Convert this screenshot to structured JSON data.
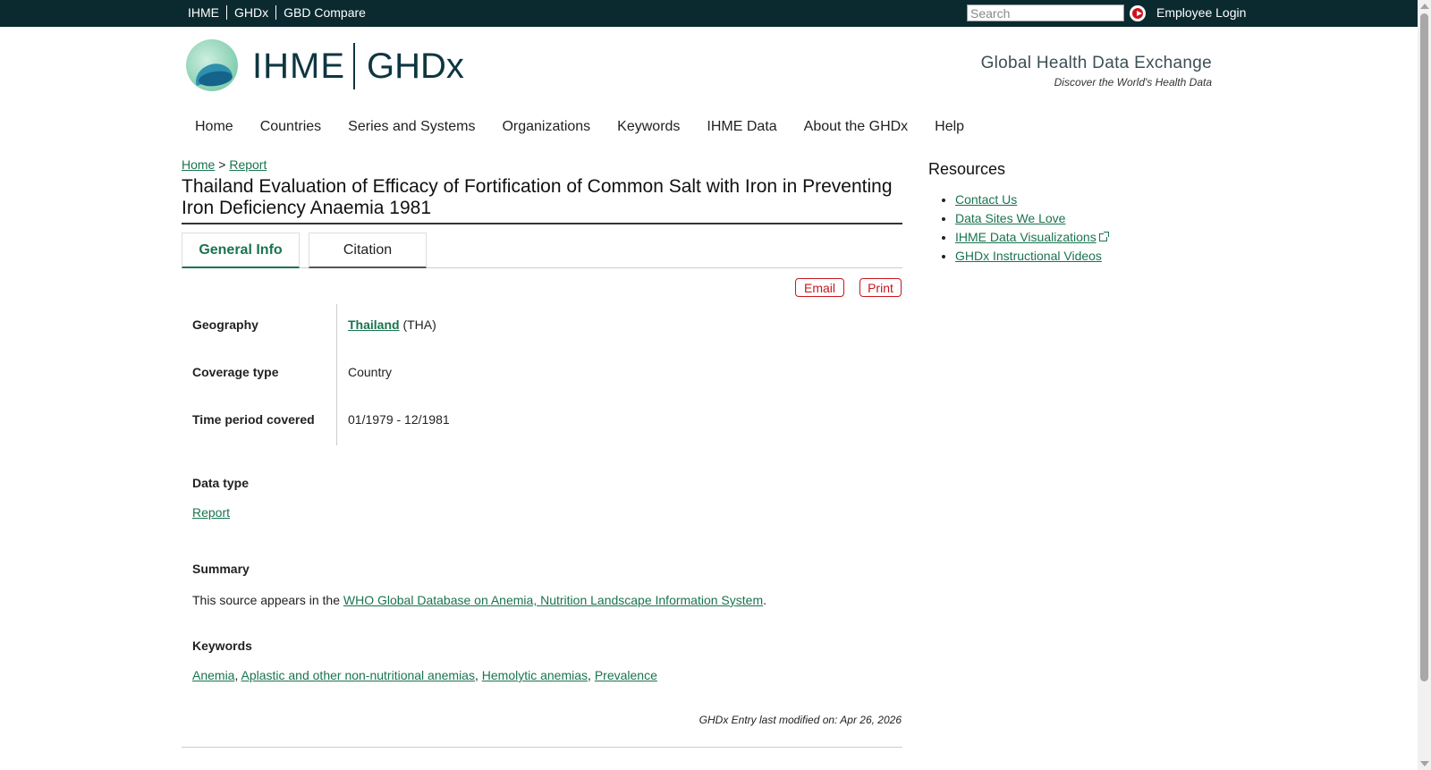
{
  "topbar": {
    "links": [
      "IHME",
      "GHDx",
      "GBD Compare"
    ],
    "search_placeholder": "Search",
    "login_label": "Employee Login",
    "bg_color": "#0b2a2f"
  },
  "header": {
    "logo_ihme": "IHME",
    "logo_ghdx": "GHDx",
    "tagline": "Global Health Data Exchange",
    "subtagline": "Discover the World's Health Data"
  },
  "mainnav": [
    "Home",
    "Countries",
    "Series and Systems",
    "Organizations",
    "Keywords",
    "IHME Data",
    "About the GHDx",
    "Help"
  ],
  "breadcrumb": {
    "home": "Home",
    "sep": ">",
    "current": "Report"
  },
  "page_title": "Thailand Evaluation of Efficacy of Fortification of Common Salt with Iron in Preventing Iron Deficiency Anaemia 1981",
  "tabs": {
    "general": "General Info",
    "citation": "Citation"
  },
  "actions": {
    "email": "Email",
    "print": "Print"
  },
  "info": {
    "geography_label": "Geography",
    "geography_link": "Thailand",
    "geography_code": "(THA)",
    "coverage_label": "Coverage type",
    "coverage_value": "Country",
    "time_label": "Time period covered",
    "time_value": "01/1979 - 12/1981"
  },
  "data_type": {
    "label": "Data type",
    "value": "Report"
  },
  "summary": {
    "label": "Summary",
    "prefix": "This source appears in the",
    "link": "WHO Global Database on Anemia, Nutrition Landscape Information System",
    "suffix": "."
  },
  "keywords": {
    "label": "Keywords",
    "items": [
      "Anemia",
      "Aplastic and other non-nutritional anemias",
      "Hemolytic anemias",
      "Prevalence"
    ]
  },
  "modified": "GHDx Entry last modified on: Apr 26, 2026",
  "resources": {
    "title": "Resources",
    "items": [
      "Contact Us",
      "Data Sites We Love",
      "IHME Data Visualizations",
      "GHDx Instructional Videos"
    ]
  },
  "colors": {
    "link": "#19744f",
    "accent_red": "#c8161d"
  }
}
